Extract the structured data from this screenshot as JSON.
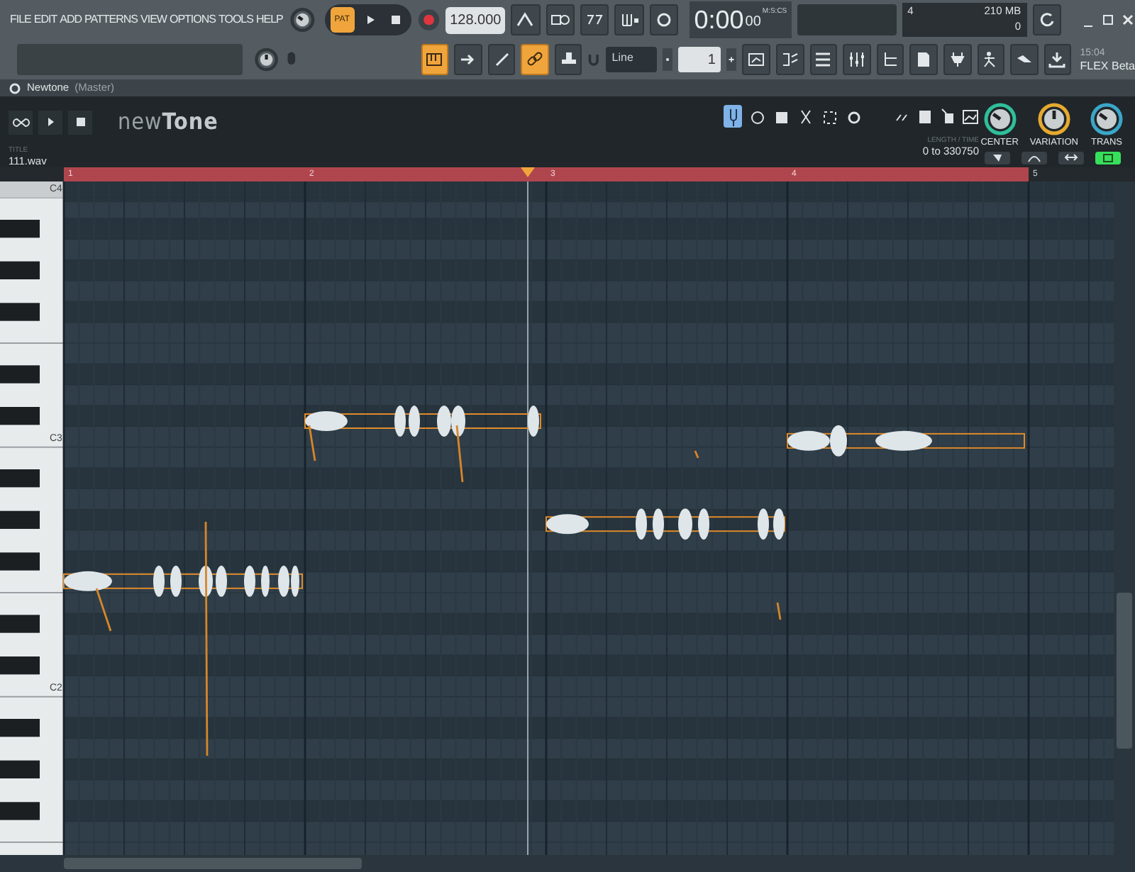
{
  "menu": [
    "FILE",
    "EDIT",
    "ADD",
    "PATTERNS",
    "VIEW",
    "OPTIONS",
    "TOOLS",
    "HELP"
  ],
  "transport": {
    "mode_label": "PAT",
    "tempo": "128.000",
    "time": "0:00",
    "time_cs": "00",
    "time_unit": "M:S:CS"
  },
  "monitor": {
    "cpu": "4",
    "ram": "210 MB",
    "poly": "0"
  },
  "tool_buttons": [
    {
      "on": true
    },
    {
      "on": false
    },
    {
      "on": false
    },
    {
      "on": true
    },
    {
      "on": false
    }
  ],
  "snap": {
    "value": "Line"
  },
  "step": {
    "value": "1"
  },
  "news": {
    "time": "15:04",
    "label": "FLEX Beta"
  },
  "plugin": {
    "title": "Newtone",
    "subtitle": "(Master)",
    "logo_a": "new",
    "logo_b": "Tone",
    "file_label": "TITLE",
    "file": "111.wav",
    "range_label": "LENGTH / TIME",
    "range": "0 to 330750",
    "tools": [
      {
        "selected": true
      },
      {
        "selected": false
      },
      {
        "selected": false
      },
      {
        "selected": false
      },
      {
        "selected": false
      },
      {
        "selected": false
      }
    ],
    "knobs": [
      {
        "label": "CENTER",
        "level": 0.3,
        "color": "#2fbf9a"
      },
      {
        "label": "VARIATION",
        "level": 0.5,
        "color": "#e6a92e"
      },
      {
        "label": "TRANS",
        "level": 0.3,
        "color": "#3aa6c8"
      }
    ],
    "toggles": [
      {
        "on": false
      },
      {
        "on": false
      },
      {
        "on": false
      },
      {
        "on": true
      }
    ]
  },
  "ruler": {
    "bars": [
      "1",
      "2",
      "3",
      "4",
      "5"
    ]
  },
  "keys": [
    "C4",
    "C3",
    "C2"
  ]
}
